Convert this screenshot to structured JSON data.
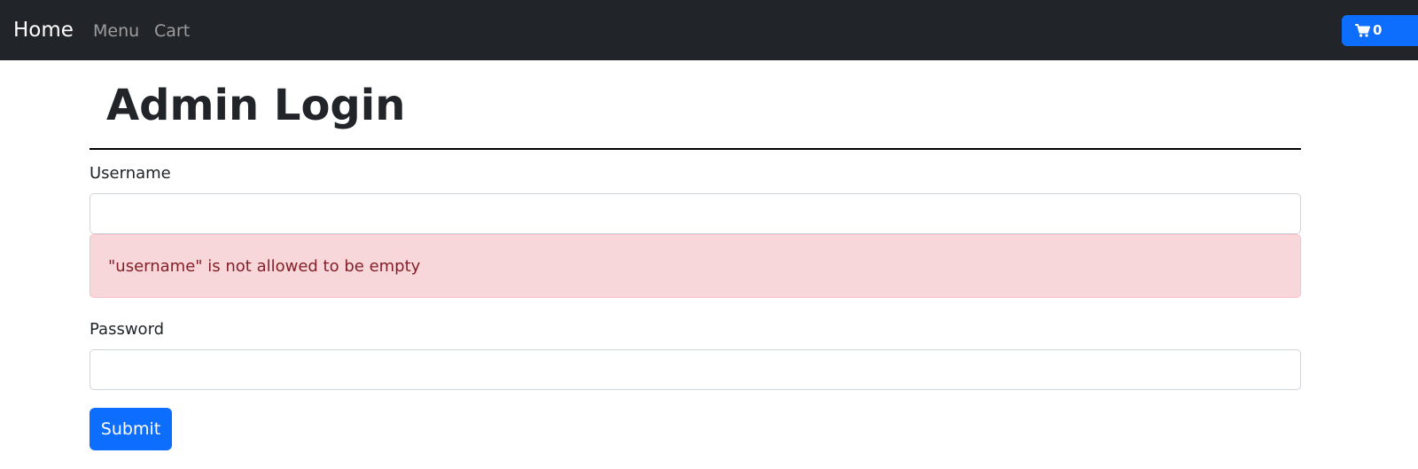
{
  "navbar": {
    "brand": "Home",
    "links": [
      {
        "label": "Menu"
      },
      {
        "label": "Cart"
      }
    ],
    "cart_button": {
      "icon": "shopping-cart-icon",
      "count": "0"
    }
  },
  "page": {
    "title": "Admin Login"
  },
  "form": {
    "username": {
      "label": "Username",
      "value": "",
      "error": "\"username\" is not allowed to be empty"
    },
    "password": {
      "label": "Password",
      "value": ""
    },
    "submit_label": "Submit"
  },
  "colors": {
    "navbar_bg": "#212529",
    "primary": "#0d6efd",
    "alert_bg": "#f8d7da",
    "alert_text": "#842029"
  }
}
